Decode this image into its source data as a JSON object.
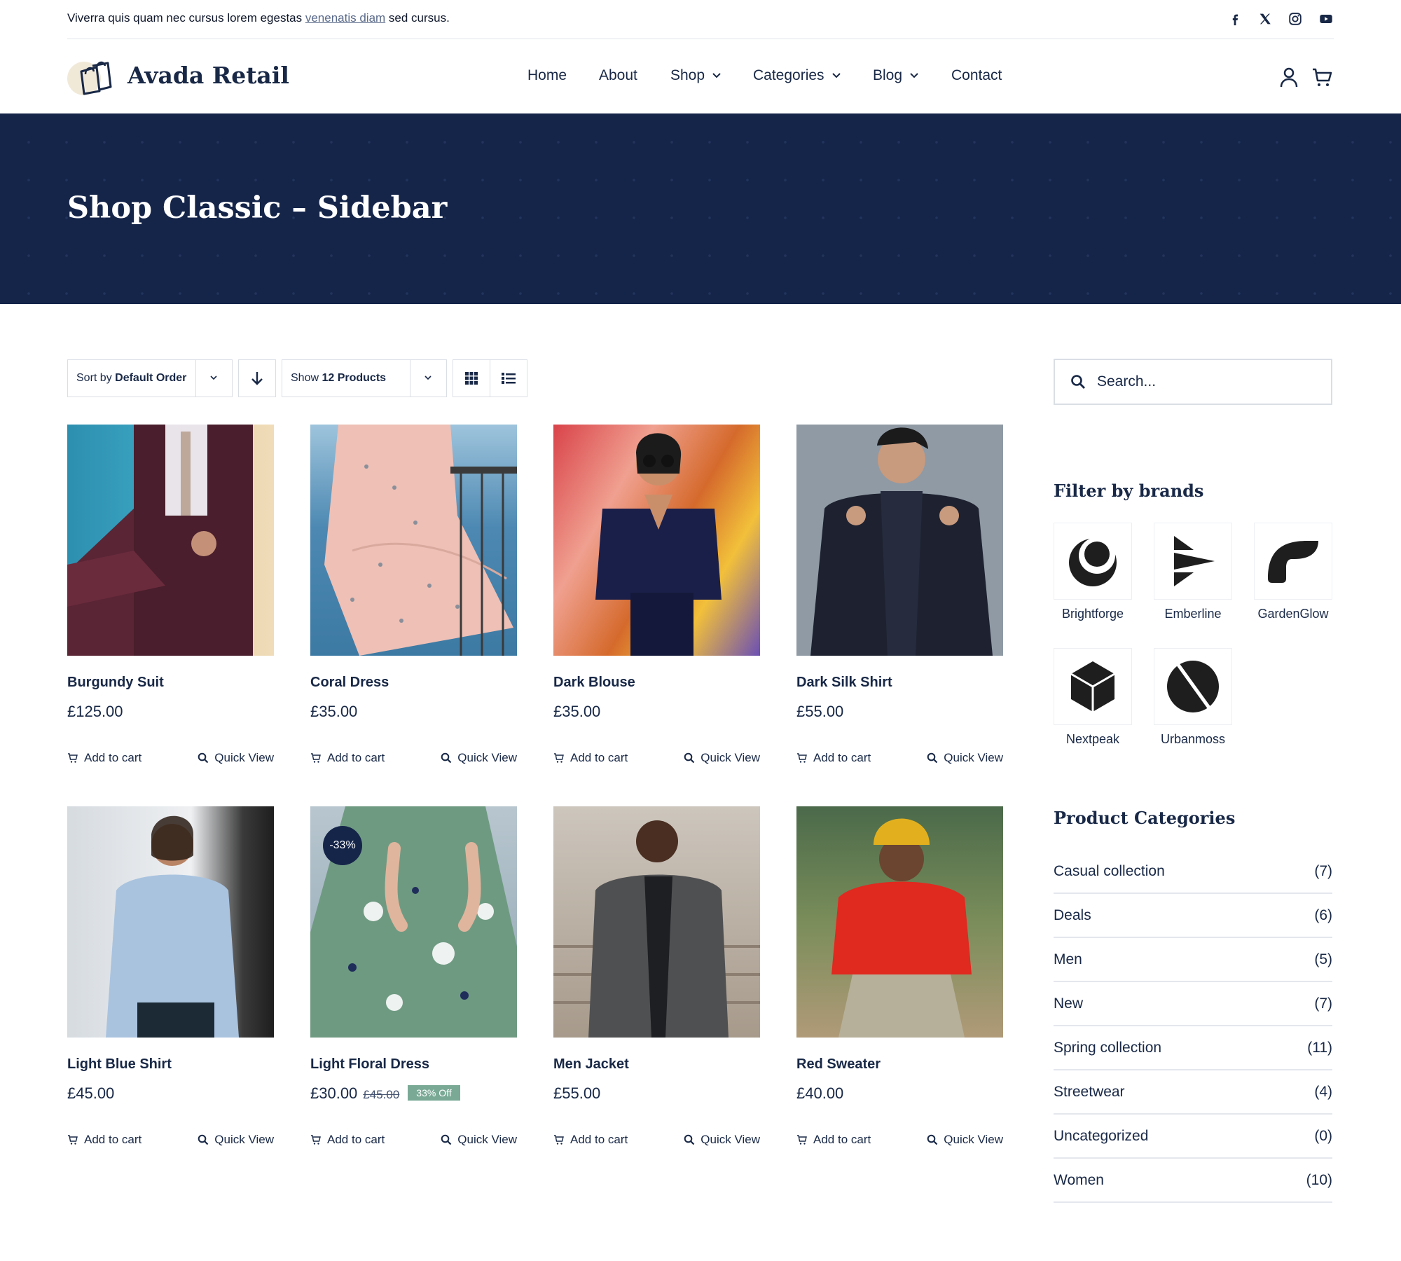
{
  "topbar": {
    "message_before": "Viverra quis quam nec cursus lorem egestas ",
    "message_link": "venenatis diam",
    "message_after": " sed cursus."
  },
  "social_icons": [
    "facebook-icon",
    "x-icon",
    "instagram-icon",
    "youtube-icon"
  ],
  "header": {
    "logo_text": "Avada Retail",
    "nav": [
      {
        "label": "Home",
        "dropdown": false
      },
      {
        "label": "About",
        "dropdown": false
      },
      {
        "label": "Shop",
        "dropdown": true
      },
      {
        "label": "Categories",
        "dropdown": true
      },
      {
        "label": "Blog",
        "dropdown": true
      },
      {
        "label": "Contact",
        "dropdown": false
      }
    ]
  },
  "hero": {
    "title": "Shop Classic – Sidebar"
  },
  "toolbar": {
    "sort_prefix": "Sort by ",
    "sort_value": "Default Order",
    "show_prefix": "Show ",
    "show_value": "12 Products"
  },
  "products": [
    {
      "name": "Burgundy Suit",
      "price": "£125.00"
    },
    {
      "name": "Coral Dress",
      "price": "£35.00"
    },
    {
      "name": "Dark Blouse",
      "price": "£35.00"
    },
    {
      "name": "Dark Silk Shirt",
      "price": "£55.00"
    },
    {
      "name": "Light Blue Shirt",
      "price": "£45.00"
    },
    {
      "name": "Light Floral Dress",
      "price": "£30.00",
      "old_price": "£45.00",
      "discount_tag": "33% Off",
      "badge": "-33%"
    },
    {
      "name": "Men Jacket",
      "price": "£55.00"
    },
    {
      "name": "Red Sweater",
      "price": "£40.00"
    }
  ],
  "product_actions": {
    "add_to_cart": "Add to cart",
    "quick_view": "Quick View"
  },
  "sidebar": {
    "search_placeholder": "Search...",
    "brands_title": "Filter by brands",
    "brands": [
      "Brightforge",
      "Emberline",
      "GardenGlow",
      "Nextpeak",
      "Urbanmoss"
    ],
    "categories_title": "Product Categories",
    "categories": [
      {
        "name": "Casual collection",
        "count": "(7)"
      },
      {
        "name": "Deals",
        "count": "(6)"
      },
      {
        "name": "Men",
        "count": "(5)"
      },
      {
        "name": "New",
        "count": "(7)"
      },
      {
        "name": "Spring collection",
        "count": "(11)"
      },
      {
        "name": "Streetwear",
        "count": "(4)"
      },
      {
        "name": "Uncategorized",
        "count": "(0)"
      },
      {
        "name": "Women",
        "count": "(10)"
      }
    ]
  },
  "colors": {
    "primary": "#182846",
    "hero_bg": "#15254a",
    "sale_tag": "#7aaa96"
  }
}
